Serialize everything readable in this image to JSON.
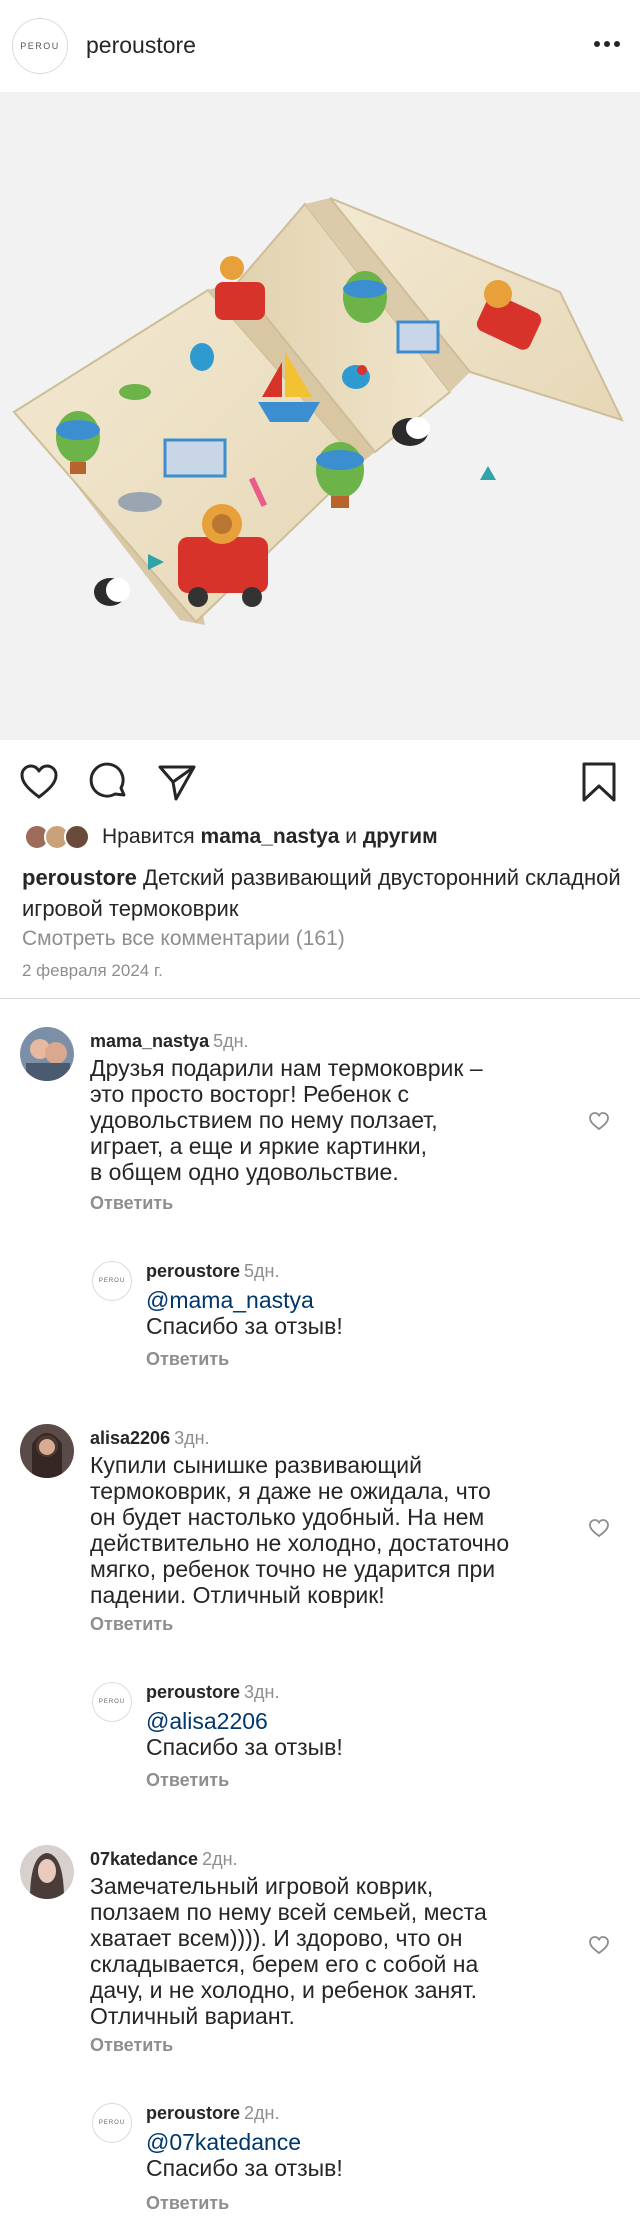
{
  "header": {
    "logo_text": "PEROU",
    "username": "peroustore",
    "more_icon": "more-horizontal-icon"
  },
  "post": {
    "image_alt": "Детский складной игровой термоковрик",
    "liked_by_prefix": "Нравится",
    "liked_by_user": "mama_nastya",
    "liked_by_and": "и",
    "liked_by_others": "другим",
    "caption_user": "peroustore",
    "caption_text": "Детский развивающий двусторонний складной игровой термоковрик",
    "view_comments": "Смотреть все комментарии (161)",
    "date": "2 февраля 2024 г."
  },
  "actions": {
    "like_icon": "heart-icon",
    "comment_icon": "comment-icon",
    "share_icon": "send-icon",
    "save_icon": "bookmark-icon"
  },
  "comments": [
    {
      "user": "mama_nastya",
      "time": "5дн.",
      "text": "Друзья подарили нам термоковрик –\nэто просто восторг! Ребенок с\nудовольствием по нему ползает,\nиграет, а еще и яркие картинки,\nв общем одно удовольствие.",
      "reply_label": "Ответить",
      "reply": {
        "user": "peroustore",
        "time": "5дн.",
        "mention": "@mama_nastya",
        "text": "Спасибо за отзыв!",
        "reply_label": "Ответить"
      }
    },
    {
      "user": "alisa2206",
      "time": "3дн.",
      "text": "Купили сынишке развивающий\nтермоковрик, я даже не ожидала, что\nон будет настолько удобный. На нем\nдействительно не холодно, достаточно\nмягко, ребенок точно не ударится при\nпадении. Отличный коврик!",
      "reply_label": "Ответить",
      "reply": {
        "user": "peroustore",
        "time": "3дн.",
        "mention": "@alisa2206",
        "text": "Спасибо за отзыв!",
        "reply_label": "Ответить"
      }
    },
    {
      "user": "07katedance",
      "time": "2дн.",
      "text": "Замечательный игровой коврик,\nползаем по нему всей семьей, места\nхватает всем)))). И здорово, что он\nскладывается, берем его с собой на\nдачу, и не холодно, и ребенок занят.\nОтличный вариант.",
      "reply_label": "Ответить",
      "reply": {
        "user": "peroustore",
        "time": "2дн.",
        "mention": "@07katedance",
        "text": "Спасибо за отзыв!",
        "reply_label": "Ответить"
      }
    }
  ],
  "colors": {
    "text": "#262626",
    "secondary": "#8e8e8e",
    "mention": "#00376b",
    "divider": "#dbdbdb",
    "image_bg": "#f2f2f2",
    "mat": "#efe3c8"
  }
}
